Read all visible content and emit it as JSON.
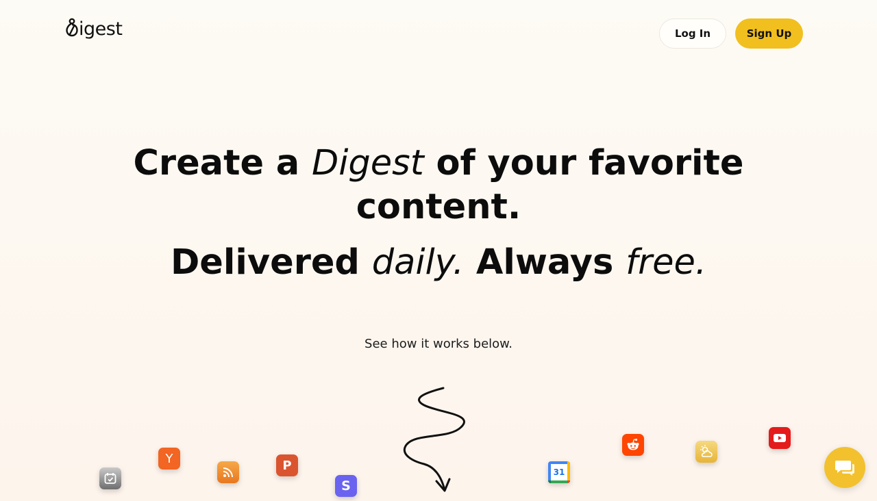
{
  "header": {
    "logo_text": "igest",
    "login_label": "Log In",
    "signup_label": "Sign Up"
  },
  "hero": {
    "line1_a": "Create a ",
    "line1_italic": "Digest",
    "line1_b": " of your favorite",
    "line2": "content.",
    "line3_a": "Delivered ",
    "line3_italic_a": "daily.",
    "line3_b": " Always ",
    "line3_italic_b": "free."
  },
  "subtitle": "See how it works below.",
  "icons": {
    "hacker_news_letter": "Y",
    "product_hunt_letter": "P",
    "substack_letter": "S",
    "calendar_number": "31"
  },
  "colors": {
    "accent": "#f1bf1e",
    "hacker_news": "#f26522",
    "product_hunt": "#da552f",
    "rss": "#f08a2a",
    "substack": "#6a63f0",
    "reddit": "#ff4500",
    "youtube": "#e41b1b",
    "weather": "#f0c95a"
  }
}
